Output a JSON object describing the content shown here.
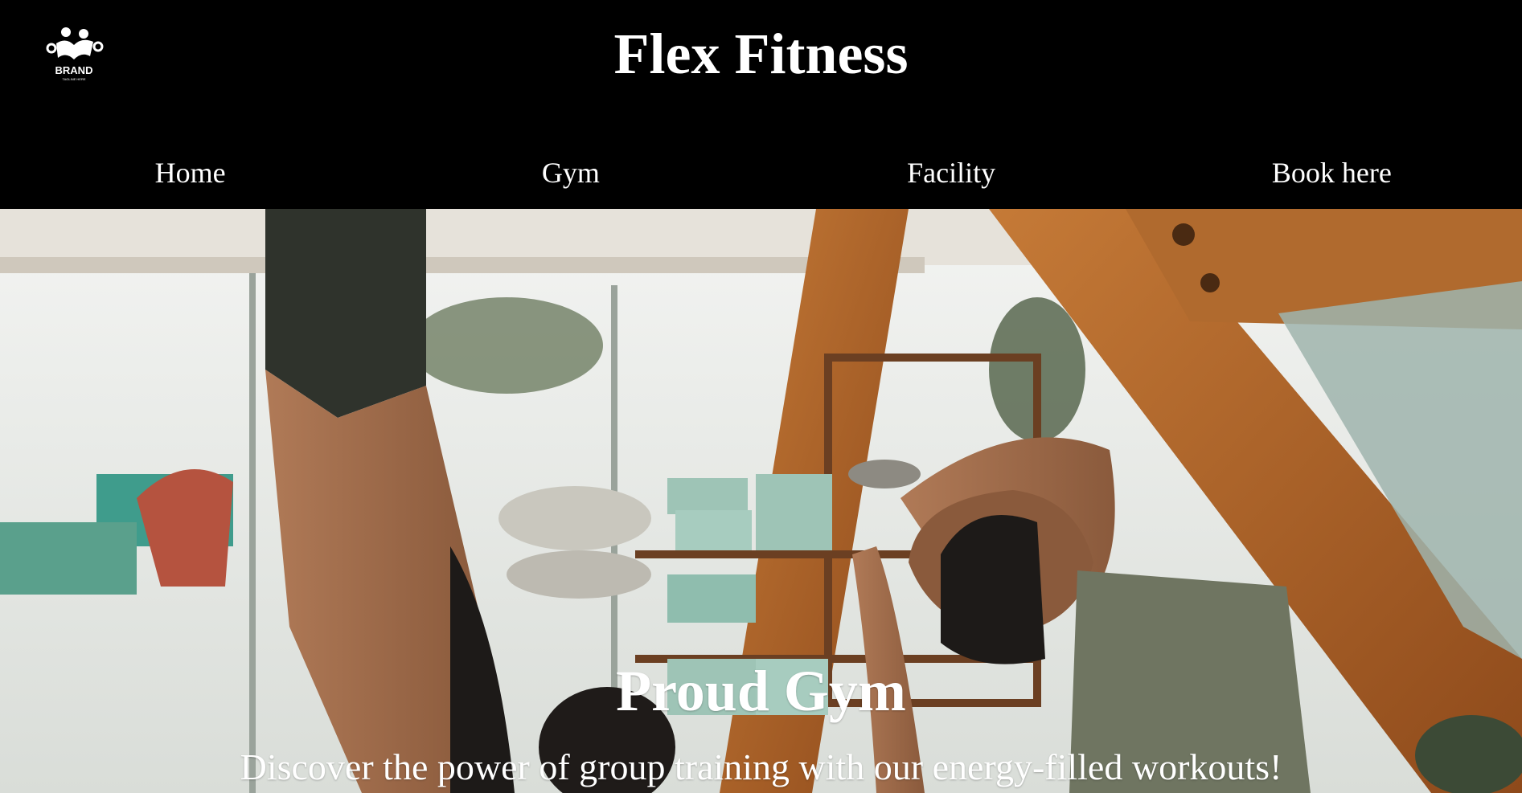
{
  "header": {
    "logo_text": "BRAND",
    "logo_tagline": "TAGLINE HERE",
    "title": "Flex Fitness"
  },
  "nav": {
    "items": [
      {
        "label": "Home"
      },
      {
        "label": "Gym"
      },
      {
        "label": "Facility"
      },
      {
        "label": "Book here"
      }
    ]
  },
  "hero": {
    "heading": "Proud Gym",
    "subheading": "Discover the power of group training with our energy-filled workouts!",
    "image_icon": "yoga-class-photo"
  },
  "colors": {
    "header_bg": "#000000",
    "text": "#ffffff",
    "wood": "#b86a2c"
  }
}
